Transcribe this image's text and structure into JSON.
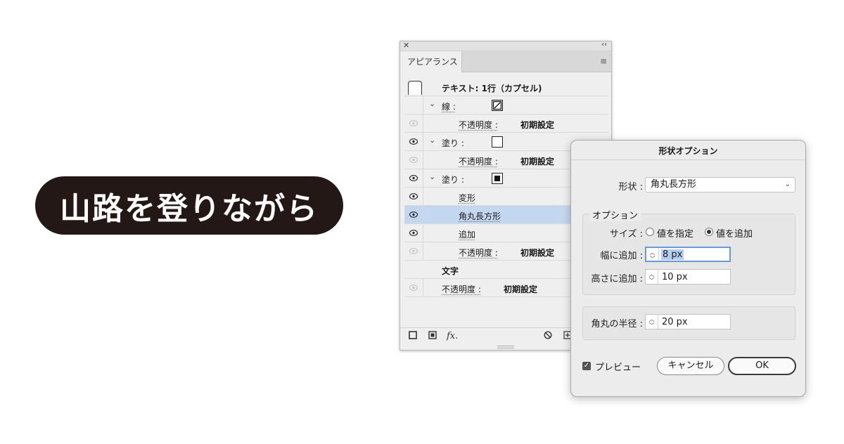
{
  "sample": {
    "text": "山路を登りながら"
  },
  "panel": {
    "close_glyph": "✕",
    "collapse_glyph": "‹‹",
    "tab_label": "アピアランス",
    "menu_glyph": "≡",
    "header_title": "テキスト: 1行（カプセル)",
    "rows": {
      "stroke_label": "線 :",
      "opacity_label_1": "不透明度 :",
      "opacity_value_1": "初期設定",
      "fill1_label": "塗り :",
      "opacity_label_2": "不透明度 :",
      "opacity_value_2": "初期設定",
      "fill2_label": "塗り :",
      "transform_label": "変形",
      "rounded_rect_label": "角丸長方形",
      "add_label": "追加",
      "opacity_label_3": "不透明度 :",
      "opacity_value_3": "初期設定",
      "characters_label": "文字",
      "opacity_label_4": "不透明度 :",
      "opacity_value_4": "初期設定"
    },
    "bottom": {
      "fx_label": "fx."
    }
  },
  "dialog": {
    "title": "形状オプション",
    "shape_label": "形状 :",
    "shape_value": "角丸長方形",
    "options_legend": "オプション",
    "size_label": "サイズ :",
    "size_option_1": "値を指定",
    "size_option_2": "値を追加",
    "width_label": "幅に追加 :",
    "width_value": "8 px",
    "height_label": "高さに追加 :",
    "height_value": "10 px",
    "radius_label": "角丸の半径 :",
    "radius_value": "20 px",
    "preview_label": "プレビュー",
    "cancel_label": "キャンセル",
    "ok_label": "OK"
  }
}
